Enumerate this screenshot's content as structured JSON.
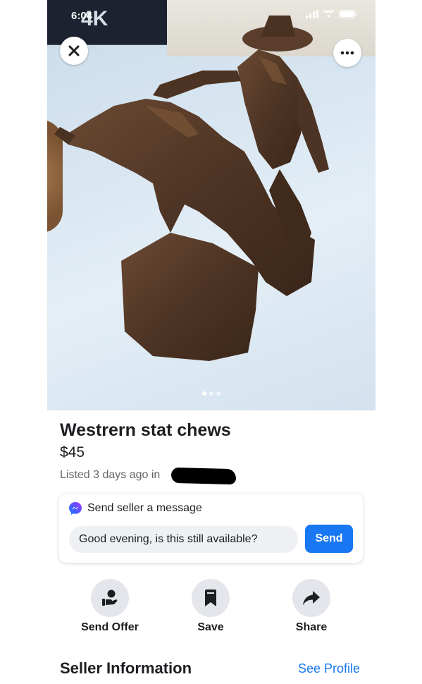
{
  "status_bar": {
    "time": "6:04"
  },
  "photo": {
    "tv_text": "4K",
    "image_count": 3,
    "active_image": 1,
    "subject": "bronze cowboy on bucking horse statue"
  },
  "nav": {
    "close_icon": "close-icon",
    "more_icon": "more-options-icon"
  },
  "listing": {
    "title": "Westrern stat chews",
    "price": "$45",
    "listed_text": "Listed 3 days ago in"
  },
  "message": {
    "heading": "Send seller a message",
    "input_value": "Good evening, is this still available?",
    "send_label": "Send"
  },
  "actions": [
    {
      "label": "Send Offer",
      "icon": "offer-icon"
    },
    {
      "label": "Save",
      "icon": "bookmark-icon"
    },
    {
      "label": "Share",
      "icon": "share-arrow-icon"
    }
  ],
  "seller": {
    "title": "Seller Information",
    "see_profile": "See Profile"
  },
  "colors": {
    "accent": "#1877f2",
    "messenger_start": "#0a7cff",
    "messenger_end": "#a033ff",
    "icon_bg": "#e4e6eb"
  }
}
